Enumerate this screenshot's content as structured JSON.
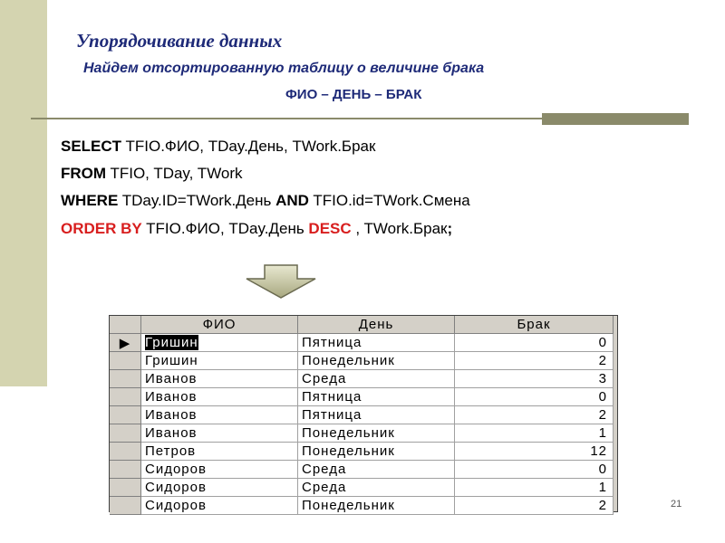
{
  "slide": {
    "title": "Упорядочивание данных",
    "subtitle": "Найдем отсортированную таблицу о величине брака",
    "columns_caption": "ФИО – ДЕНЬ – БРАК",
    "page_number": "21"
  },
  "sql": {
    "line1_kw": "SELECT",
    "line1_rest": " TFIO.ФИО, TDay.День, TWork.Брак",
    "line2_kw": "FROM",
    "line2_rest": " TFIO, TDay, TWork",
    "line3_kw": "WHERE",
    "line3_mid": " TDay.ID=TWork.День ",
    "line3_kw2": "AND",
    "line3_rest": " TFIO.id=TWork.Смена",
    "line4_kw": "ORDER BY",
    "line4_mid": " TFIO.ФИО, TDay.День ",
    "line4_kw2": "DESC",
    "line4_rest": " , TWork.Брак",
    "line4_end": ";"
  },
  "table": {
    "headers": [
      "ФИО",
      "День",
      "Брак"
    ],
    "current_row_marker": "▶",
    "rows": [
      [
        "Гришин",
        "Пятница",
        "0"
      ],
      [
        "Гришин",
        "Понедельник",
        "2"
      ],
      [
        "Иванов",
        "Среда",
        "3"
      ],
      [
        "Иванов",
        "Пятница",
        "0"
      ],
      [
        "Иванов",
        "Пятница",
        "2"
      ],
      [
        "Иванов",
        "Понедельник",
        "1"
      ],
      [
        "Петров",
        "Понедельник",
        "12"
      ],
      [
        "Сидоров",
        "Среда",
        "0"
      ],
      [
        "Сидоров",
        "Среда",
        "1"
      ],
      [
        "Сидоров",
        "Понедельник",
        "2"
      ]
    ]
  },
  "colors": {
    "title": "#1e2a78",
    "keyword_red": "#d81e1e",
    "sidebar": "#d4d4b0",
    "grid_chrome": "#d4d0c8"
  }
}
